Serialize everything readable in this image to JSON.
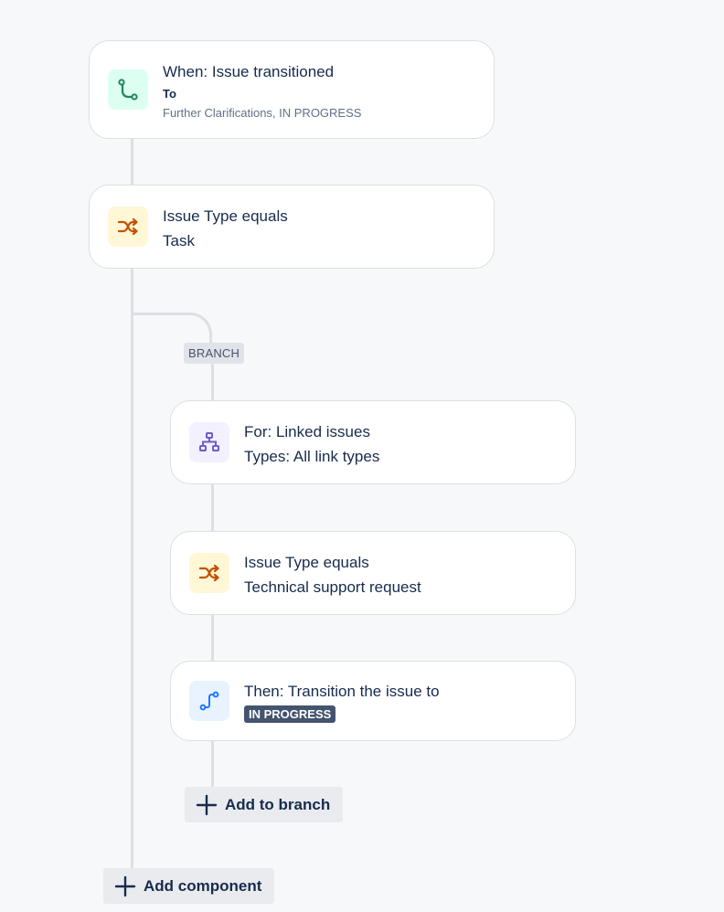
{
  "trigger": {
    "title": "When: Issue transitioned",
    "subtitle": "To",
    "detail": "Further Clarifications, IN PROGRESS",
    "icon": "transition-path-icon",
    "icon_color": "#1f845a",
    "icon_bg": "#dcfff1"
  },
  "condition1": {
    "title": "Issue Type equals",
    "value": "Task",
    "icon": "shuffle-icon",
    "icon_color": "#c25100",
    "icon_bg": "#fff7d6"
  },
  "branch": {
    "label": "BRANCH",
    "for_card": {
      "title": "For: Linked issues",
      "value": "Types: All link types",
      "icon": "hierarchy-icon",
      "icon_color": "#6e5dc6",
      "icon_bg": "#f3f0ff"
    },
    "condition": {
      "title": "Issue Type equals",
      "value": "Technical support request",
      "icon": "shuffle-icon",
      "icon_color": "#c25100",
      "icon_bg": "#fff7d6"
    },
    "action": {
      "title": "Then: Transition the issue to",
      "status": "IN PROGRESS",
      "icon": "transition-path-icon",
      "icon_color": "#1d7afc",
      "icon_bg": "#e9f2ff"
    },
    "add_button_label": "Add to branch"
  },
  "add_component_label": "Add component",
  "colors": {
    "background": "#f7f8f9",
    "connector": "#dcdfe4",
    "lozenge": "#44546f"
  }
}
